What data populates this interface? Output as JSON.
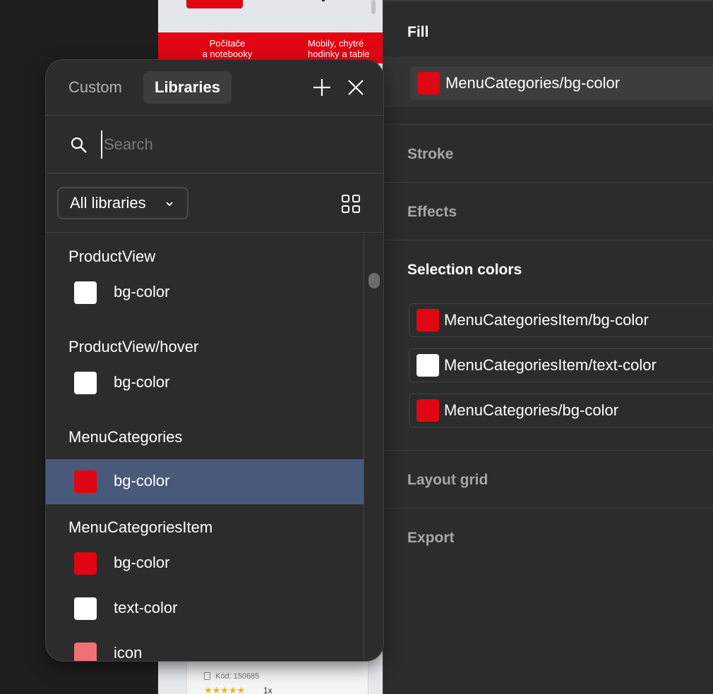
{
  "canvas_preview": {
    "menu_item_1": "Počítače\na notebooky",
    "menu_item_2": "Mobily, chytré\nhodinky a table",
    "product_code": "Kód: 150685",
    "rating_stars": "★★★★★",
    "quantity": "1x"
  },
  "properties_panel": {
    "fill": {
      "title": "Fill",
      "style_name": "MenuCategories/bg-color",
      "swatch_color": "#e10613"
    },
    "stroke_title": "Stroke",
    "effects_title": "Effects",
    "selection_colors": {
      "title": "Selection colors",
      "items": [
        {
          "label": "MenuCategoriesItem/bg-color",
          "color": "#e10613"
        },
        {
          "label": "MenuCategoriesItem/text-color",
          "color": "#ffffff"
        },
        {
          "label": "MenuCategories/bg-color",
          "color": "#e10613"
        }
      ]
    },
    "layout_grid_title": "Layout grid",
    "export_title": "Export"
  },
  "library_popover": {
    "tabs": [
      {
        "label": "Custom",
        "active": false
      },
      {
        "label": "Libraries",
        "active": true
      }
    ],
    "add_icon": "plus-icon",
    "close_icon": "close-icon",
    "search": {
      "placeholder": "Search",
      "value": ""
    },
    "library_filter": {
      "selected": "All libraries"
    },
    "view_icon": "grid-view-icon",
    "groups": [
      {
        "title": "ProductView",
        "items": [
          {
            "label": "bg-color",
            "color": "#ffffff",
            "selected": false
          }
        ]
      },
      {
        "title": "ProductView/hover",
        "items": [
          {
            "label": "bg-color",
            "color": "#ffffff",
            "selected": false
          }
        ]
      },
      {
        "title": "MenuCategories",
        "items": [
          {
            "label": "bg-color",
            "color": "#e10613",
            "selected": true
          }
        ]
      },
      {
        "title": "MenuCategoriesItem",
        "items": [
          {
            "label": "bg-color",
            "color": "#e10613",
            "selected": false
          },
          {
            "label": "text-color",
            "color": "#ffffff",
            "selected": false
          },
          {
            "label": "icon",
            "color": "#f07078",
            "selected": false
          }
        ]
      }
    ]
  },
  "colors": {
    "brand_red": "#e10613",
    "selection_highlight": "#49597a",
    "panel_bg": "#2c2c2c"
  }
}
